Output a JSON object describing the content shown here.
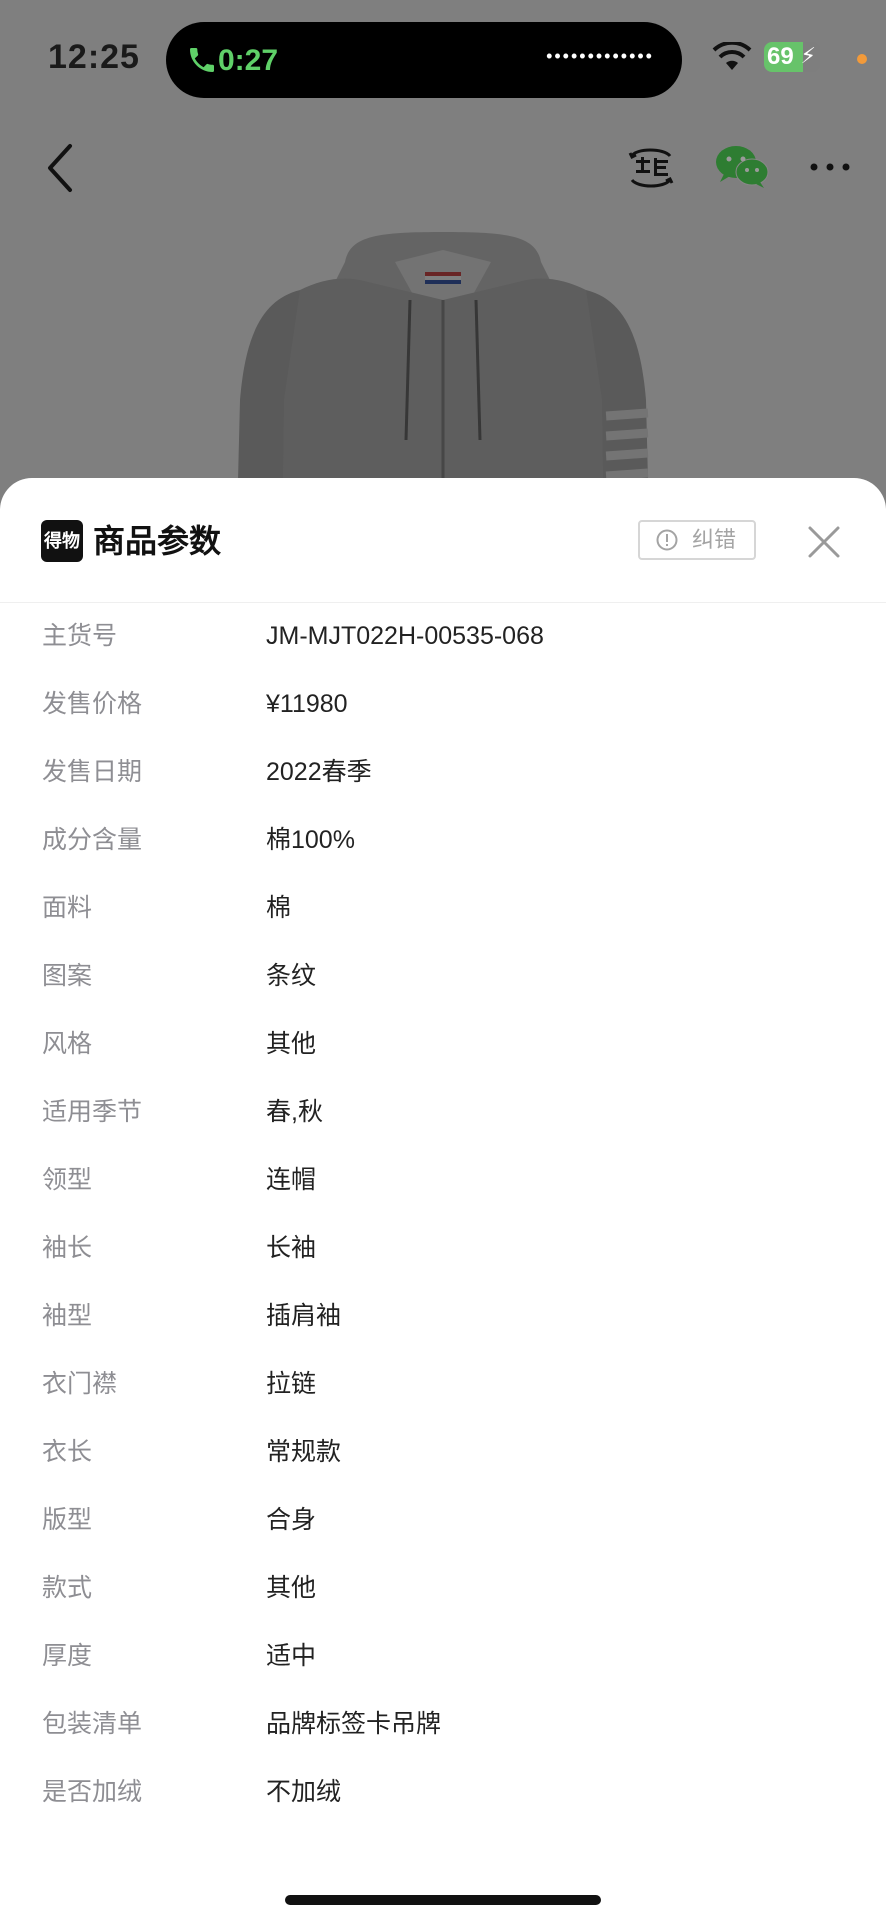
{
  "status_bar": {
    "time": "12:25",
    "call_time": "0:27",
    "call_dots": "•••••••••••••",
    "battery_level": "69",
    "battery_fraction": 0.69
  },
  "nav": {
    "back_icon": "chevron-left-icon",
    "sell_icon": "sell-icon",
    "share_icon": "wechat-icon",
    "more_icon": "more-icon"
  },
  "sheet": {
    "logo_text": "得物",
    "title": "商品参数",
    "report_label": "纠错",
    "params": [
      {
        "label": "主货号",
        "value": "JM-MJT022H-00535-068"
      },
      {
        "label": "发售价格",
        "value": "¥11980"
      },
      {
        "label": "发售日期",
        "value": "2022春季"
      },
      {
        "label": "成分含量",
        "value": "棉100%"
      },
      {
        "label": "面料",
        "value": "棉"
      },
      {
        "label": "图案",
        "value": "条纹"
      },
      {
        "label": "风格",
        "value": "其他"
      },
      {
        "label": "适用季节",
        "value": "春,秋"
      },
      {
        "label": "领型",
        "value": "连帽"
      },
      {
        "label": "袖长",
        "value": "长袖"
      },
      {
        "label": "袖型",
        "value": "插肩袖"
      },
      {
        "label": "衣门襟",
        "value": "拉链"
      },
      {
        "label": "衣长",
        "value": "常规款"
      },
      {
        "label": "版型",
        "value": "合身"
      },
      {
        "label": "款式",
        "value": "其他"
      },
      {
        "label": "厚度",
        "value": "适中"
      },
      {
        "label": "包装清单",
        "value": "品牌标签卡吊牌"
      },
      {
        "label": "是否加绒",
        "value": "不加绒"
      }
    ]
  },
  "colors": {
    "overlay": "rgba(0,0,0,0.5)",
    "call_green": "#5fd068",
    "label_gray": "#8e8e93",
    "value_dark": "#222222"
  }
}
